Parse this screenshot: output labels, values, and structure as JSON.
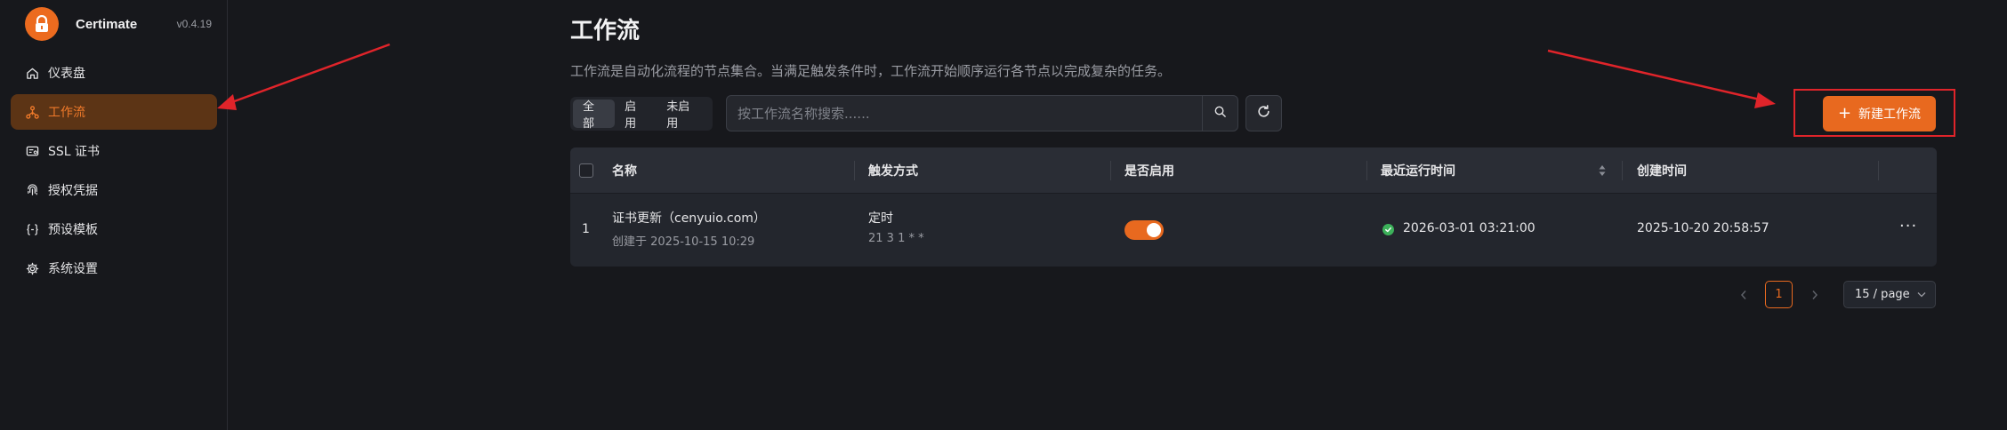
{
  "brand": {
    "name": "Certimate",
    "version": "v0.4.19"
  },
  "sidebar": {
    "items": [
      {
        "label": "仪表盘",
        "icon": "home-icon"
      },
      {
        "label": "工作流",
        "icon": "workflow-icon",
        "active": true
      },
      {
        "label": "SSL 证书",
        "icon": "certificate-icon"
      },
      {
        "label": "授权凭据",
        "icon": "fingerprint-icon"
      },
      {
        "label": "预设模板",
        "icon": "braces-icon"
      },
      {
        "label": "系统设置",
        "icon": "gear-icon"
      }
    ]
  },
  "page": {
    "title": "工作流",
    "description": "工作流是自动化流程的节点集合。当满足触发条件时，工作流开始顺序运行各节点以完成复杂的任务。"
  },
  "filters": {
    "all": "全部",
    "enabled": "启用",
    "disabled": "未启用",
    "selected": "all"
  },
  "search": {
    "placeholder": "按工作流名称搜索......",
    "value": ""
  },
  "new_button": {
    "label": "新建工作流"
  },
  "table": {
    "columns": [
      "名称",
      "触发方式",
      "是否启用",
      "最近运行时间",
      "创建时间"
    ],
    "rows": [
      {
        "index": "1",
        "name": "证书更新（cenyuio.com）",
        "created_prefix": "创建于 2025-10-15 10:29",
        "trigger": "定时",
        "cron": "21 3 1 * *",
        "enabled": true,
        "last_run": "2026-03-01 03:21:00",
        "last_run_status": "success",
        "created_at": "2025-10-20 20:58:57"
      }
    ]
  },
  "pagination": {
    "current": "1",
    "page_size": "15 / page"
  },
  "colors": {
    "accent": "#e8691f",
    "success": "#3cb15a",
    "annotation": "#e0242a"
  }
}
